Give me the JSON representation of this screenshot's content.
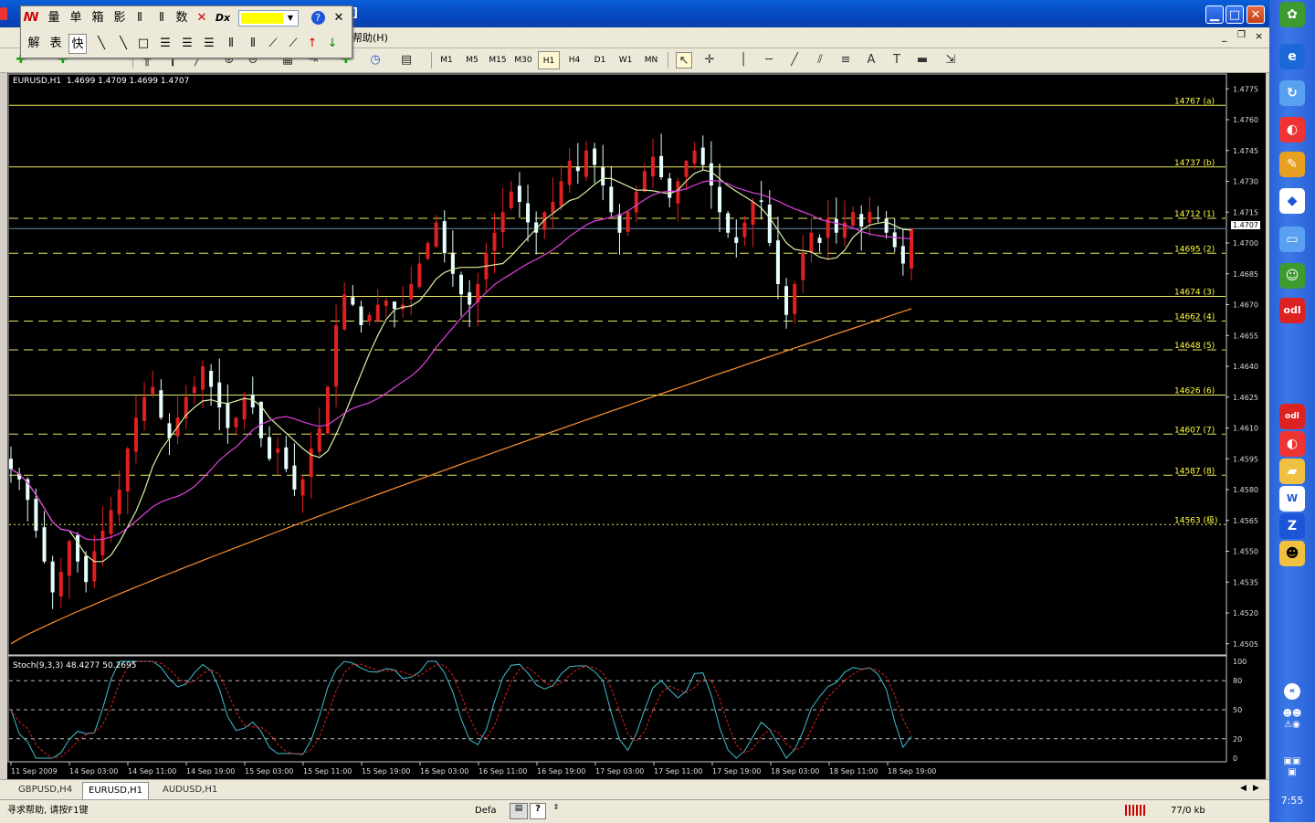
{
  "palette": {
    "row1": [
      "量",
      "单",
      "箱",
      "影",
      "数"
    ],
    "row2": [
      "解",
      "表",
      "快"
    ]
  },
  "menu": {
    "help": "帮助(H)"
  },
  "timeframes": [
    "M1",
    "M5",
    "M15",
    "M30",
    "H1",
    "H4",
    "D1",
    "W1",
    "MN"
  ],
  "active_timeframe": "H1",
  "chart": {
    "header": "EURUSD,H1  1.4699 1.4709 1.4699 1.4707",
    "current_price_label": "1.4707",
    "indicator_header": "Stoch(9,3,3) 48.4277 50.2695"
  },
  "chart_data": {
    "type": "candlestick",
    "symbol": "EURUSD",
    "timeframe": "H1",
    "ohlc_current": {
      "open": 1.4699,
      "high": 1.4709,
      "low": 1.4699,
      "close": 1.4707
    },
    "price_axis_ticks": [
      "1.4775",
      "1.4760",
      "1.4745",
      "1.4730",
      "1.4715",
      "1.4700",
      "1.4685",
      "1.4670",
      "1.4655",
      "1.4640",
      "1.4625",
      "1.4610",
      "1.4595",
      "1.4580",
      "1.4565",
      "1.4550",
      "1.4535",
      "1.4520",
      "1.4505"
    ],
    "time_axis_ticks": [
      "11 Sep 2009",
      "14 Sep 03:00",
      "14 Sep 11:00",
      "14 Sep 19:00",
      "15 Sep 03:00",
      "15 Sep 11:00",
      "15 Sep 19:00",
      "16 Sep 03:00",
      "16 Sep 11:00",
      "16 Sep 19:00",
      "17 Sep 03:00",
      "17 Sep 11:00",
      "17 Sep 19:00",
      "18 Sep 03:00",
      "18 Sep 11:00",
      "18 Sep 19:00"
    ],
    "ylim": [
      1.45,
      1.478
    ],
    "levels": [
      {
        "price": 1.4767,
        "label": "14767 (a)",
        "style": "solid"
      },
      {
        "price": 1.4737,
        "label": "14737 (b)",
        "style": "solid"
      },
      {
        "price": 1.4712,
        "label": "14712 (1)",
        "style": "dashed"
      },
      {
        "price": 1.4695,
        "label": "14695 (2)",
        "style": "dashed"
      },
      {
        "price": 1.4674,
        "label": "14674 (3)",
        "style": "solid"
      },
      {
        "price": 1.4662,
        "label": "14662 (4)",
        "style": "dashed"
      },
      {
        "price": 1.4648,
        "label": "14648 (5)",
        "style": "dashed"
      },
      {
        "price": 1.4626,
        "label": "14626 (6)",
        "style": "solid"
      },
      {
        "price": 1.4607,
        "label": "14607 (7)",
        "style": "dashed"
      },
      {
        "price": 1.4587,
        "label": "14587 (8)",
        "style": "dashed"
      },
      {
        "price": 1.4563,
        "label": "14563 (极)",
        "style": "dotted"
      }
    ],
    "stoch_axis_ticks": [
      "100",
      "80",
      "50",
      "20",
      "0"
    ],
    "stoch_levels": [
      80,
      50,
      20
    ],
    "close_path": [
      1.459,
      1.4585,
      1.4575,
      1.456,
      1.4545,
      1.453,
      1.454,
      1.4555,
      1.4545,
      1.4535,
      1.455,
      1.456,
      1.457,
      1.458,
      1.46,
      1.4615,
      1.4625,
      1.463,
      1.4615,
      1.4605,
      1.4615,
      1.4625,
      1.463,
      1.464,
      1.463,
      1.462,
      1.461,
      1.4615,
      1.4625,
      1.462,
      1.4605,
      1.4595,
      1.46,
      1.459,
      1.458,
      1.4585,
      1.46,
      1.461,
      1.463,
      1.466,
      1.4675,
      1.467,
      1.466,
      1.4665,
      1.467,
      1.4672,
      1.4668,
      1.467,
      1.468,
      1.469,
      1.47,
      1.471,
      1.4695,
      1.4685,
      1.4675,
      1.467,
      1.468,
      1.4695,
      1.4705,
      1.4715,
      1.4725,
      1.472,
      1.471,
      1.4705,
      1.4715,
      1.472,
      1.473,
      1.474,
      1.4735,
      1.4745,
      1.4738,
      1.4728,
      1.4715,
      1.4705,
      1.4715,
      1.4725,
      1.4735,
      1.4742,
      1.4732,
      1.4722,
      1.473,
      1.474,
      1.4745,
      1.4738,
      1.4728,
      1.4715,
      1.4705,
      1.47,
      1.471,
      1.472,
      1.472,
      1.47,
      1.468,
      1.4665,
      1.468,
      1.4695,
      1.4705,
      1.47,
      1.4712,
      1.4705,
      1.471,
      1.4715,
      1.4708,
      1.4715,
      1.4712,
      1.4705,
      1.4698,
      1.469,
      1.4707
    ]
  },
  "tabs": [
    "GBPUSD,H4",
    "EURUSD,H1",
    "AUDUSD,H1"
  ],
  "active_tab": "EURUSD,H1",
  "status": {
    "help": "寻求帮助, 请按F1键",
    "profile": "Defa",
    "traffic": "77/0 kb"
  },
  "clock": "7:55"
}
